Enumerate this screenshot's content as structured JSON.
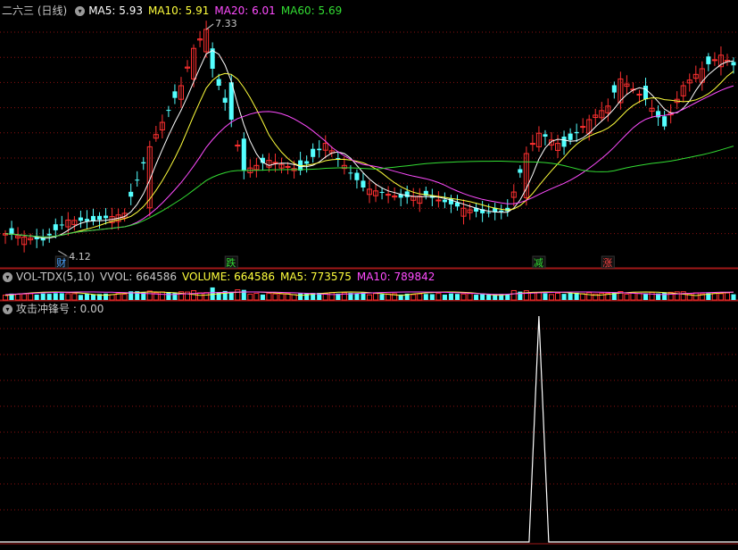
{
  "main_panel": {
    "title": "二六三 (日线)",
    "ma_labels": [
      {
        "text": "MA5: 5.93",
        "color": "#ffffff"
      },
      {
        "text": "MA10: 5.91",
        "color": "#ffff3c"
      },
      {
        "text": "MA20: 6.01",
        "color": "#ff4cff"
      },
      {
        "text": "MA60: 5.69",
        "color": "#33dd33"
      }
    ],
    "annotations": {
      "high": "7.33",
      "low": "4.12"
    },
    "events": [
      {
        "label": "财",
        "index": 9,
        "color": "#4aa3ff"
      },
      {
        "label": "跌",
        "index": 36,
        "color": "#33dd33"
      },
      {
        "label": "减",
        "index": 85,
        "color": "#33dd33"
      },
      {
        "label": "涨",
        "index": 96,
        "color": "#ff4444"
      }
    ]
  },
  "volume_panel": {
    "title": "VOL-TDX(5,10)",
    "labels": [
      {
        "text": "VVOL: 664586",
        "color": "#c8c8c8"
      },
      {
        "text": "VOLUME: 664586",
        "color": "#ffff3c"
      },
      {
        "text": "MA5: 773575",
        "color": "#ffff3c"
      },
      {
        "text": "MA10: 789842",
        "color": "#ff4cff"
      }
    ]
  },
  "signal_panel": {
    "title": "攻击冲锋号 : 0.00"
  },
  "colors": {
    "up": "#ff3030",
    "down": "#54ffff",
    "grid": "#8a1010",
    "signal": "#ffffff"
  },
  "chart_data": [
    {
      "type": "candlestick",
      "title": "二六三 (日线)",
      "ylim": [
        4.0,
        7.5
      ],
      "count": 117,
      "high_point": {
        "index": 32,
        "value": 7.33
      },
      "low_point": {
        "index": 9,
        "value": 4.12
      },
      "candles_sampled": [
        {
          "i": 0,
          "o": 4.3,
          "c": 4.32
        },
        {
          "i": 6,
          "o": 4.26,
          "c": 4.22
        },
        {
          "i": 10,
          "o": 4.42,
          "c": 4.52
        },
        {
          "i": 14,
          "o": 4.58,
          "c": 4.5
        },
        {
          "i": 19,
          "o": 4.55,
          "c": 4.62
        },
        {
          "i": 23,
          "o": 4.7,
          "c": 5.6
        },
        {
          "i": 28,
          "o": 6.3,
          "c": 6.5
        },
        {
          "i": 30,
          "o": 6.6,
          "c": 7.05
        },
        {
          "i": 32,
          "o": 7.0,
          "c": 7.33
        },
        {
          "i": 33,
          "o": 7.05,
          "c": 6.75
        },
        {
          "i": 36,
          "o": 6.55,
          "c": 6.0
        },
        {
          "i": 38,
          "o": 5.72,
          "c": 5.25
        },
        {
          "i": 42,
          "o": 5.3,
          "c": 5.4
        },
        {
          "i": 47,
          "o": 5.4,
          "c": 5.25
        },
        {
          "i": 51,
          "o": 5.55,
          "c": 5.65
        },
        {
          "i": 57,
          "o": 5.1,
          "c": 5.0
        },
        {
          "i": 63,
          "o": 4.9,
          "c": 4.85
        },
        {
          "i": 67,
          "o": 4.95,
          "c": 4.88
        },
        {
          "i": 72,
          "o": 4.78,
          "c": 4.72
        },
        {
          "i": 76,
          "o": 4.68,
          "c": 4.62
        },
        {
          "i": 80,
          "o": 4.7,
          "c": 4.65
        },
        {
          "i": 83,
          "o": 4.85,
          "c": 5.5
        },
        {
          "i": 85,
          "o": 5.6,
          "c": 5.8
        },
        {
          "i": 89,
          "o": 5.75,
          "c": 5.6
        },
        {
          "i": 93,
          "o": 5.8,
          "c": 6.0
        },
        {
          "i": 96,
          "o": 6.1,
          "c": 6.2
        },
        {
          "i": 98,
          "o": 6.25,
          "c": 6.6
        },
        {
          "i": 102,
          "o": 6.5,
          "c": 6.3
        },
        {
          "i": 105,
          "o": 6.05,
          "c": 5.9
        },
        {
          "i": 108,
          "o": 6.35,
          "c": 6.5
        },
        {
          "i": 111,
          "o": 6.55,
          "c": 6.75
        },
        {
          "i": 114,
          "o": 6.78,
          "c": 6.95
        },
        {
          "i": 116,
          "o": 6.85,
          "c": 6.8
        }
      ],
      "series": [
        {
          "name": "MA5",
          "value": 5.93
        },
        {
          "name": "MA10",
          "value": 5.91
        },
        {
          "name": "MA20",
          "value": 6.01
        },
        {
          "name": "MA60",
          "value": 5.69
        }
      ]
    },
    {
      "type": "bar",
      "title": "VOL-TDX(5,10)",
      "series": [
        {
          "name": "VVOL",
          "value": 664586
        },
        {
          "name": "VOLUME",
          "value": 664586
        },
        {
          "name": "MA5",
          "value": 773575
        },
        {
          "name": "MA10",
          "value": 789842
        }
      ]
    },
    {
      "type": "line",
      "title": "攻击冲锋号",
      "ylim": [
        0,
        1
      ],
      "spike": {
        "index": 85,
        "value": 1
      },
      "last_value": 0.0
    }
  ]
}
